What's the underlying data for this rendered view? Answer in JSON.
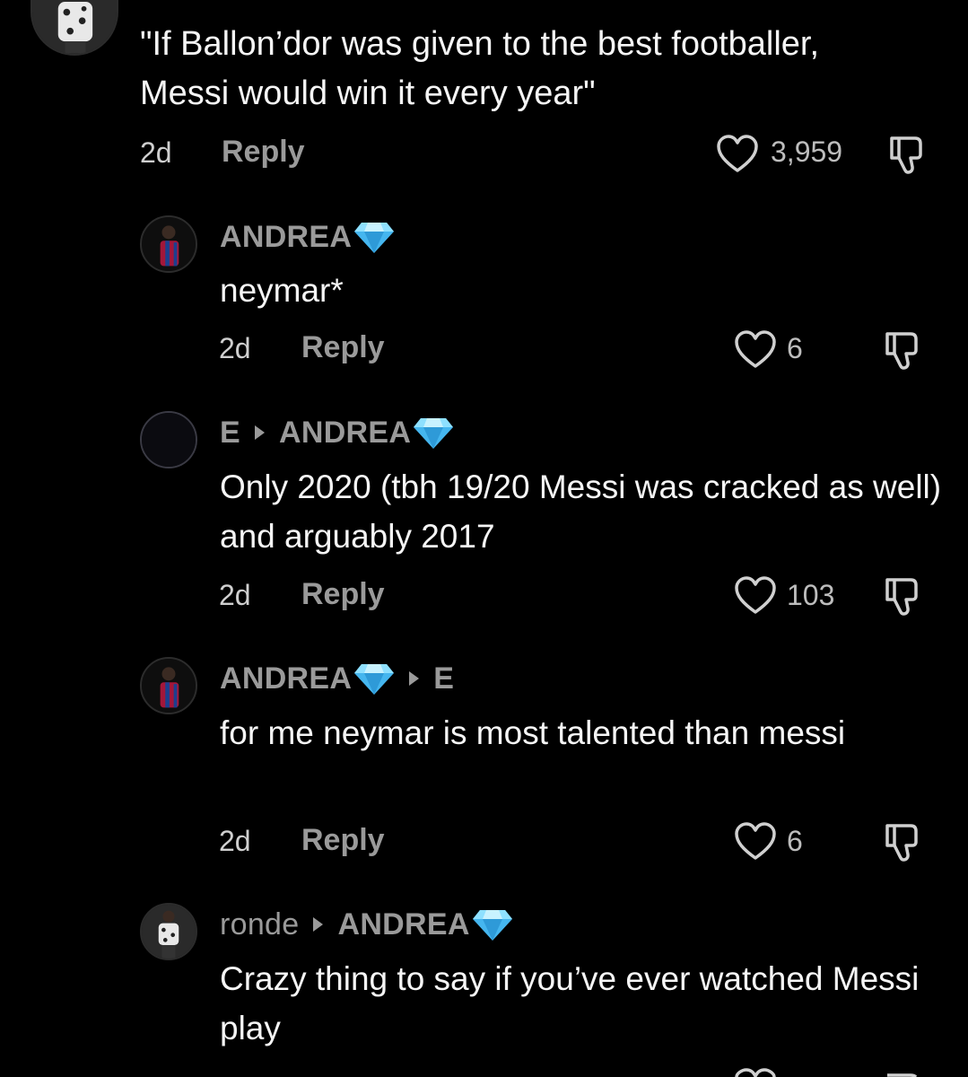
{
  "comments": [
    {
      "text": "\"If Ballon’dor was given to the best footballer, Messi would win it every year\"",
      "time": "2d",
      "reply_label": "Reply",
      "likes": "3,959"
    },
    {
      "user": "ANDREA",
      "user_badge": "diamond-icon",
      "text": "neymar*",
      "time": "2d",
      "reply_label": "Reply",
      "likes": "6"
    },
    {
      "user": "E",
      "reply_to": "ANDREA",
      "reply_to_badge": "diamond-icon",
      "text": "Only 2020 (tbh 19/20 Messi was cracked as well) and arguably 2017",
      "time": "2d",
      "reply_label": "Reply",
      "likes": "103"
    },
    {
      "user": "ANDREA",
      "user_badge": "diamond-icon",
      "reply_to": "E",
      "text": "for me neymar is most talented than messi",
      "time": "2d",
      "reply_label": "Reply",
      "likes": "6"
    },
    {
      "user": "ronde",
      "reply_to": "ANDREA",
      "reply_to_badge": "diamond-icon",
      "text": "Crazy thing to say if you’ve ever watched Messi play"
    }
  ],
  "colors": {
    "background": "#000000",
    "username": "#9a9a9a",
    "text": "#f5f5f5",
    "diamond": "#5bc8f5"
  }
}
